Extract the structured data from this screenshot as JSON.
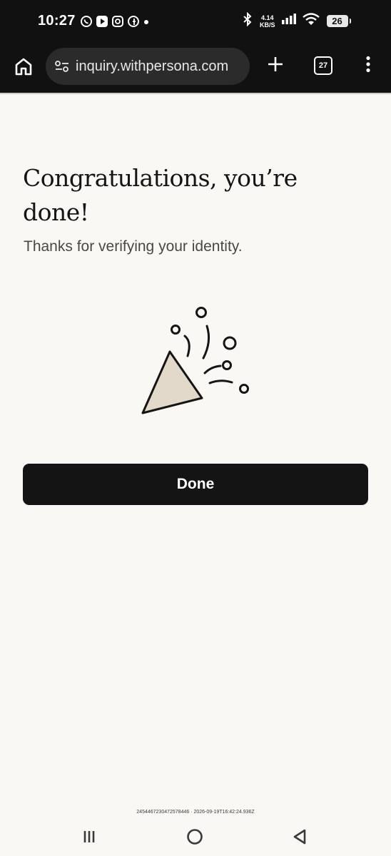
{
  "status_bar": {
    "time": "10:27",
    "app_icons": [
      "whatsapp-icon",
      "play-icon",
      "instagram-icon",
      "facebook-icon",
      "dot-icon"
    ],
    "network_speed_value": "4.14",
    "network_speed_unit": "KB/S",
    "battery_level": "26",
    "indicators": [
      "bluetooth-icon",
      "signal-icon",
      "wifi-icon",
      "battery-icon"
    ]
  },
  "browser": {
    "url": "inquiry.withpersona.com",
    "tab_count": "27",
    "icons": [
      "home-icon",
      "site-settings-icon",
      "plus-icon",
      "tabs-icon",
      "more-vertical-icon"
    ]
  },
  "content": {
    "title": "Congratulations, you’re done!",
    "subtitle": "Thanks for verifying your identity.",
    "illustration": "party-popper-icon",
    "done_button_label": "Done",
    "reference": "2454467230472578446 · 2026-09-19T16:42:24.936Z"
  },
  "system_nav": {
    "icons": [
      "recents-icon",
      "home-circle-icon",
      "back-icon"
    ]
  },
  "colors": {
    "status_bar_bg": "#111111",
    "page_bg": "#faf8f5",
    "button_bg": "#141414",
    "popper_fill": "#e3d9cb"
  }
}
